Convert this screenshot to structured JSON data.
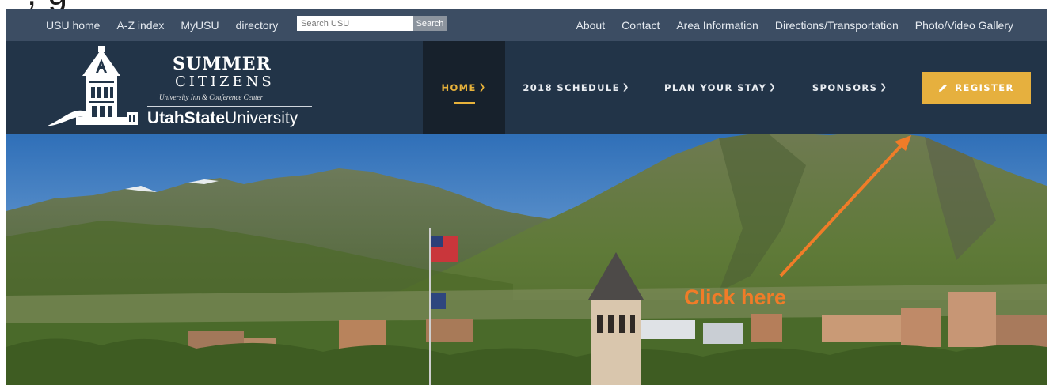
{
  "top_cropped_text": ", g",
  "utility_bar": {
    "left_links": [
      "USU home",
      "A-Z index",
      "MyUSU",
      "directory"
    ],
    "search": {
      "placeholder": "Search USU",
      "button_label": "Search"
    },
    "right_links": [
      "About",
      "Contact",
      "Area Information",
      "Directions/Transportation",
      "Photo/Video Gallery"
    ]
  },
  "logo": {
    "line1": "SUMMER",
    "line2": "CITIZENS",
    "line3": "University Inn & Conference Center",
    "university_bold": "UtahState",
    "university_regular": "University"
  },
  "nav": {
    "items": [
      {
        "label": "HOME",
        "active": true
      },
      {
        "label": "2018 SCHEDULE",
        "active": false
      },
      {
        "label": "PLAN YOUR STAY",
        "active": false
      },
      {
        "label": "SPONSORS",
        "active": false
      }
    ],
    "register_label": "REGISTER"
  },
  "annotation": {
    "label": "Click here",
    "color": "#f07c28"
  },
  "colors": {
    "utility_bar": "#3c4d63",
    "nav_bar": "#223448",
    "accent": "#e6b03e"
  },
  "icons": {
    "register": "pencil-icon",
    "dropdown": "chevron-down-icon"
  }
}
